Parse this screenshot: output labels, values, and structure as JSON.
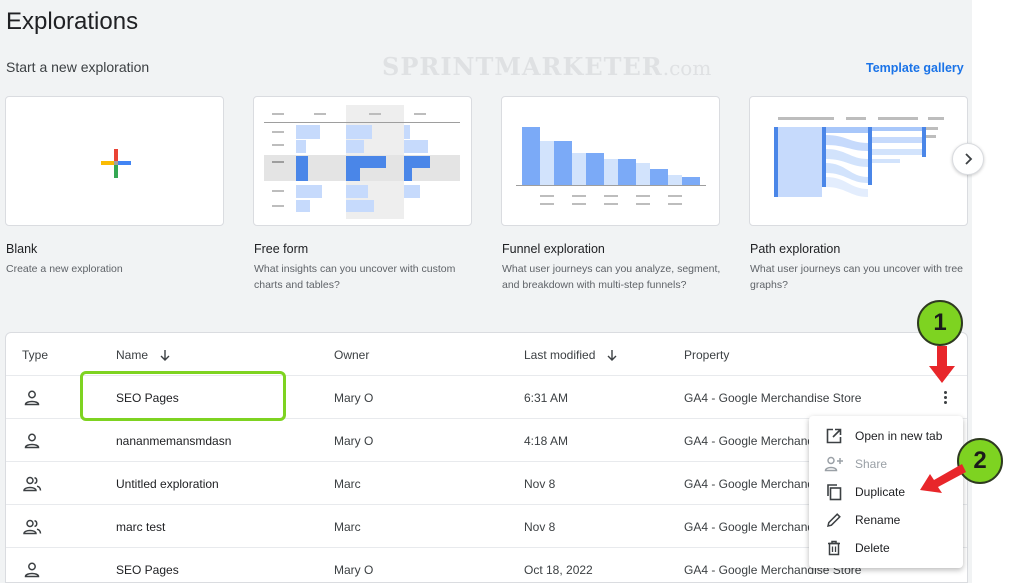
{
  "header": {
    "title": "Explorations",
    "section_title": "Start a new exploration",
    "template_gallery_label": "Template gallery",
    "watermark_main": "SPRINTMARKETER",
    "watermark_domain": ".com"
  },
  "templates": [
    {
      "title": "Blank",
      "description": "Create a new exploration",
      "icon": "plus-icon"
    },
    {
      "title": "Free form",
      "description": "What insights can you uncover with custom charts and tables?",
      "icon": "free-form-preview"
    },
    {
      "title": "Funnel exploration",
      "description": "What user journeys can you analyze, segment, and breakdown with multi-step funnels?",
      "icon": "funnel-preview"
    },
    {
      "title": "Path exploration",
      "description": "What user journeys can you uncover with tree graphs?",
      "icon": "path-preview"
    }
  ],
  "table": {
    "columns": {
      "type": "Type",
      "name": "Name",
      "owner": "Owner",
      "last_modified": "Last modified",
      "property": "Property"
    },
    "rows": [
      {
        "type_icon": "person-icon",
        "name": "SEO Pages",
        "owner": "Mary O",
        "last_modified": "6:31 AM",
        "property": "GA4 - Google Merchandise Store"
      },
      {
        "type_icon": "person-icon",
        "name": "nananmemansmdasn",
        "owner": "Mary O",
        "last_modified": "4:18 AM",
        "property": "GA4 - Google Merchand"
      },
      {
        "type_icon": "people-icon",
        "name": "Untitled exploration",
        "owner": "Marc",
        "last_modified": "Nov 8",
        "property": "GA4 - Google Merchand"
      },
      {
        "type_icon": "people-icon",
        "name": "marc test",
        "owner": "Marc",
        "last_modified": "Nov 8",
        "property": "GA4 - Google Merchand"
      },
      {
        "type_icon": "person-icon",
        "name": "SEO Pages",
        "owner": "Mary O",
        "last_modified": "Oct 18, 2022",
        "property": "GA4 - Google Merchandise Store"
      }
    ]
  },
  "context_menu": {
    "items": [
      {
        "label": "Open in new tab",
        "icon": "open-in-new-icon",
        "enabled": true
      },
      {
        "label": "Share",
        "icon": "person-add-icon",
        "enabled": false
      },
      {
        "label": "Duplicate",
        "icon": "copy-icon",
        "enabled": true
      },
      {
        "label": "Rename",
        "icon": "pencil-icon",
        "enabled": true
      },
      {
        "label": "Delete",
        "icon": "trash-icon",
        "enabled": true
      }
    ]
  },
  "annotations": {
    "step1": "1",
    "step2": "2"
  },
  "colors": {
    "accent": "#1a73e8",
    "highlight": "#7ed321",
    "arrow": "#e8262a",
    "chart_blue": "#8ab4f8"
  }
}
